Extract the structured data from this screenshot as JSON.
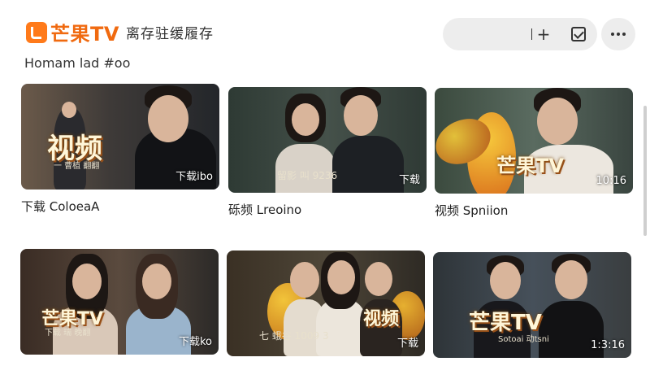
{
  "header": {
    "logo_text": "芒果TV",
    "subtitle": "离存驻缓履存"
  },
  "actions": {
    "add_icon": "plus-icon",
    "check_icon": "checkbox-icon",
    "more_icon": "more-dots-icon"
  },
  "section": {
    "title": "Homam lad #oo"
  },
  "cards": [
    {
      "overlay": "视频",
      "overlay_sub": "一 曹植 翻翻",
      "badge": "下载ibo",
      "caption": "下载 ColoeaA"
    },
    {
      "overlay": "",
      "overlay_sub": "留影 叫 9236",
      "badge": "下载",
      "caption": "砾频 Lreoino"
    },
    {
      "overlay": "芒果TV",
      "overlay_sub": "",
      "badge": "10:16",
      "caption": "视频 Spniion"
    },
    {
      "overlay": "芒果TV",
      "overlay_sub": "下载 瑞 晚翻",
      "badge": "下载ko",
      "caption": ""
    },
    {
      "overlay": "视频",
      "overlay_sub": "七 蛾谷 1009 3",
      "badge": "下载",
      "caption": ""
    },
    {
      "overlay": "芒果TV",
      "overlay_sub": "Sotoai 动tsni",
      "badge": "1:3:16",
      "caption": ""
    }
  ],
  "colors": {
    "brand": "#f06a10",
    "pill_bg": "#ededed"
  }
}
